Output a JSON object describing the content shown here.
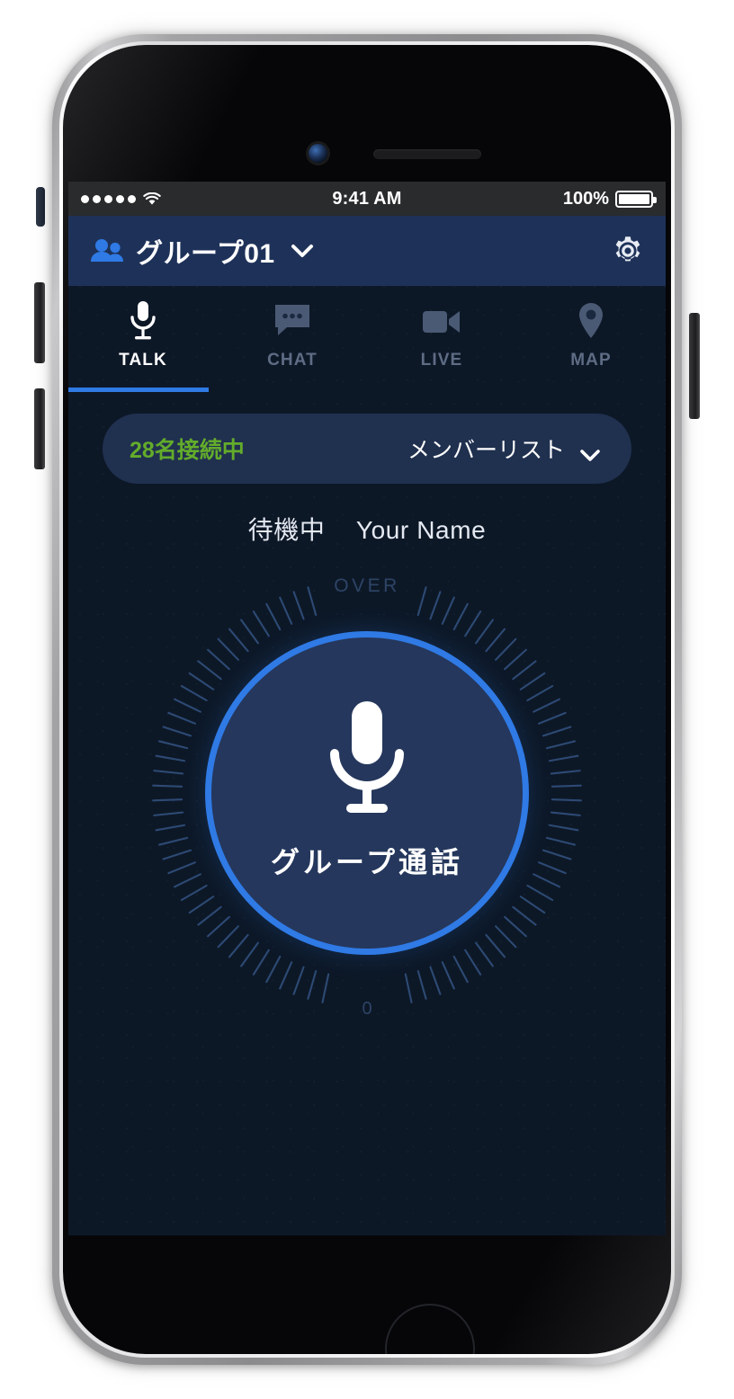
{
  "status_bar": {
    "signal_dots": 5,
    "wifi_icon": "wifi-icon",
    "time": "9:41 AM",
    "battery_percent": "100%",
    "battery_icon": "battery-full-icon"
  },
  "app_bar": {
    "group_icon": "people-group-icon",
    "group_name": "グループ01",
    "dropdown_icon": "chevron-down-icon",
    "settings_icon": "gear-icon"
  },
  "tabs": [
    {
      "id": "talk",
      "label": "TALK",
      "icon": "microphone-icon",
      "active": true
    },
    {
      "id": "chat",
      "label": "CHAT",
      "icon": "chat-bubble-icon",
      "active": false
    },
    {
      "id": "live",
      "label": "LIVE",
      "icon": "video-camera-icon",
      "active": false
    },
    {
      "id": "map",
      "label": "MAP",
      "icon": "map-pin-icon",
      "active": false
    }
  ],
  "member_bar": {
    "connected_text": "28名接続中",
    "member_list_label": "メンバーリスト",
    "expand_icon": "chevron-down-icon"
  },
  "standby": {
    "state_text": "待機中",
    "user_name": "Your Name"
  },
  "dial": {
    "top_label": "OVER",
    "bottom_label": "0",
    "tick_count": 90
  },
  "talk_button": {
    "icon": "microphone-icon",
    "label": "グループ通話"
  },
  "colors": {
    "screen_bg": "#0d1827",
    "app_bar_bg": "#1e3259",
    "status_bar_bg": "#2a2b2d",
    "accent_blue": "#2f7ae5",
    "button_fill": "#25375c",
    "member_bar_bg": "#20304f",
    "connected_green": "#63ac2b",
    "tab_inactive": "#5e6c84",
    "dial_tick": "#2d4a74",
    "dial_label": "#2d4466"
  }
}
